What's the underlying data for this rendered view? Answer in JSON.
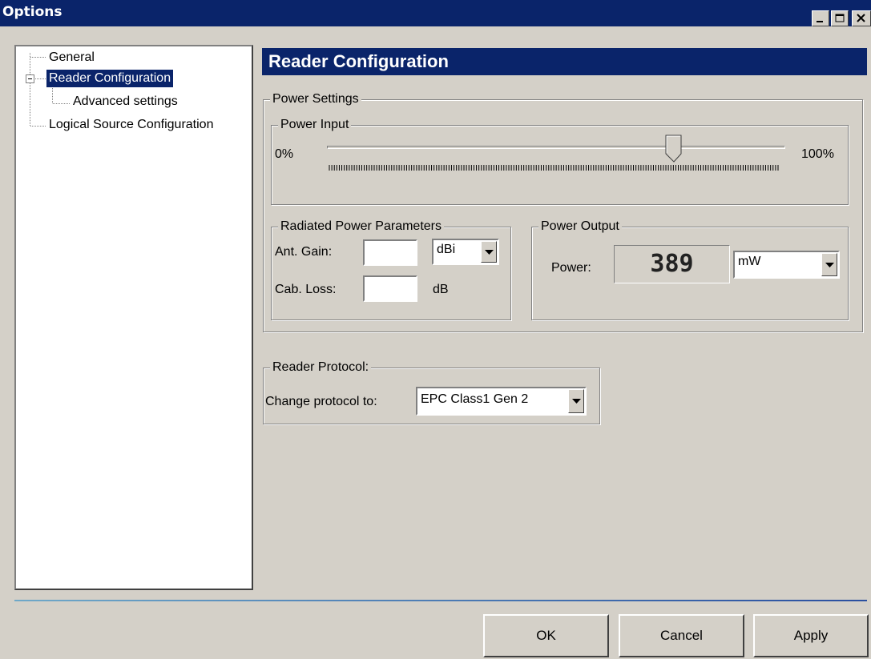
{
  "window": {
    "title": "Options"
  },
  "tree": {
    "items": [
      {
        "label": "General"
      },
      {
        "label": "Reader Configuration",
        "selected": true
      },
      {
        "label": "Advanced settings"
      },
      {
        "label": "Logical Source Configuration"
      }
    ]
  },
  "panel": {
    "title": "Reader Configuration"
  },
  "power_settings": {
    "label": "Power Settings",
    "power_input": {
      "label": "Power Input",
      "min_label": "0%",
      "max_label": "100%",
      "slider_value_percent": 77
    },
    "radiated": {
      "label": "Radiated Power Parameters",
      "ant_gain_label": "Ant. Gain:",
      "ant_gain_value": "",
      "ant_gain_unit": "dBi",
      "cab_loss_label": "Cab. Loss:",
      "cab_loss_value": "",
      "cab_loss_unit": "dB"
    },
    "output": {
      "label": "Power Output",
      "power_label": "Power:",
      "power_value": "389",
      "unit": "mW"
    }
  },
  "protocol": {
    "label": "Reader Protocol:",
    "change_label": "Change protocol to:",
    "value": "EPC Class1 Gen 2"
  },
  "buttons": {
    "ok": "OK",
    "cancel": "Cancel",
    "apply": "Apply"
  },
  "colors": {
    "title_bar": "#0a246a",
    "face": "#d4d0c8",
    "selection": "#0a246a"
  }
}
